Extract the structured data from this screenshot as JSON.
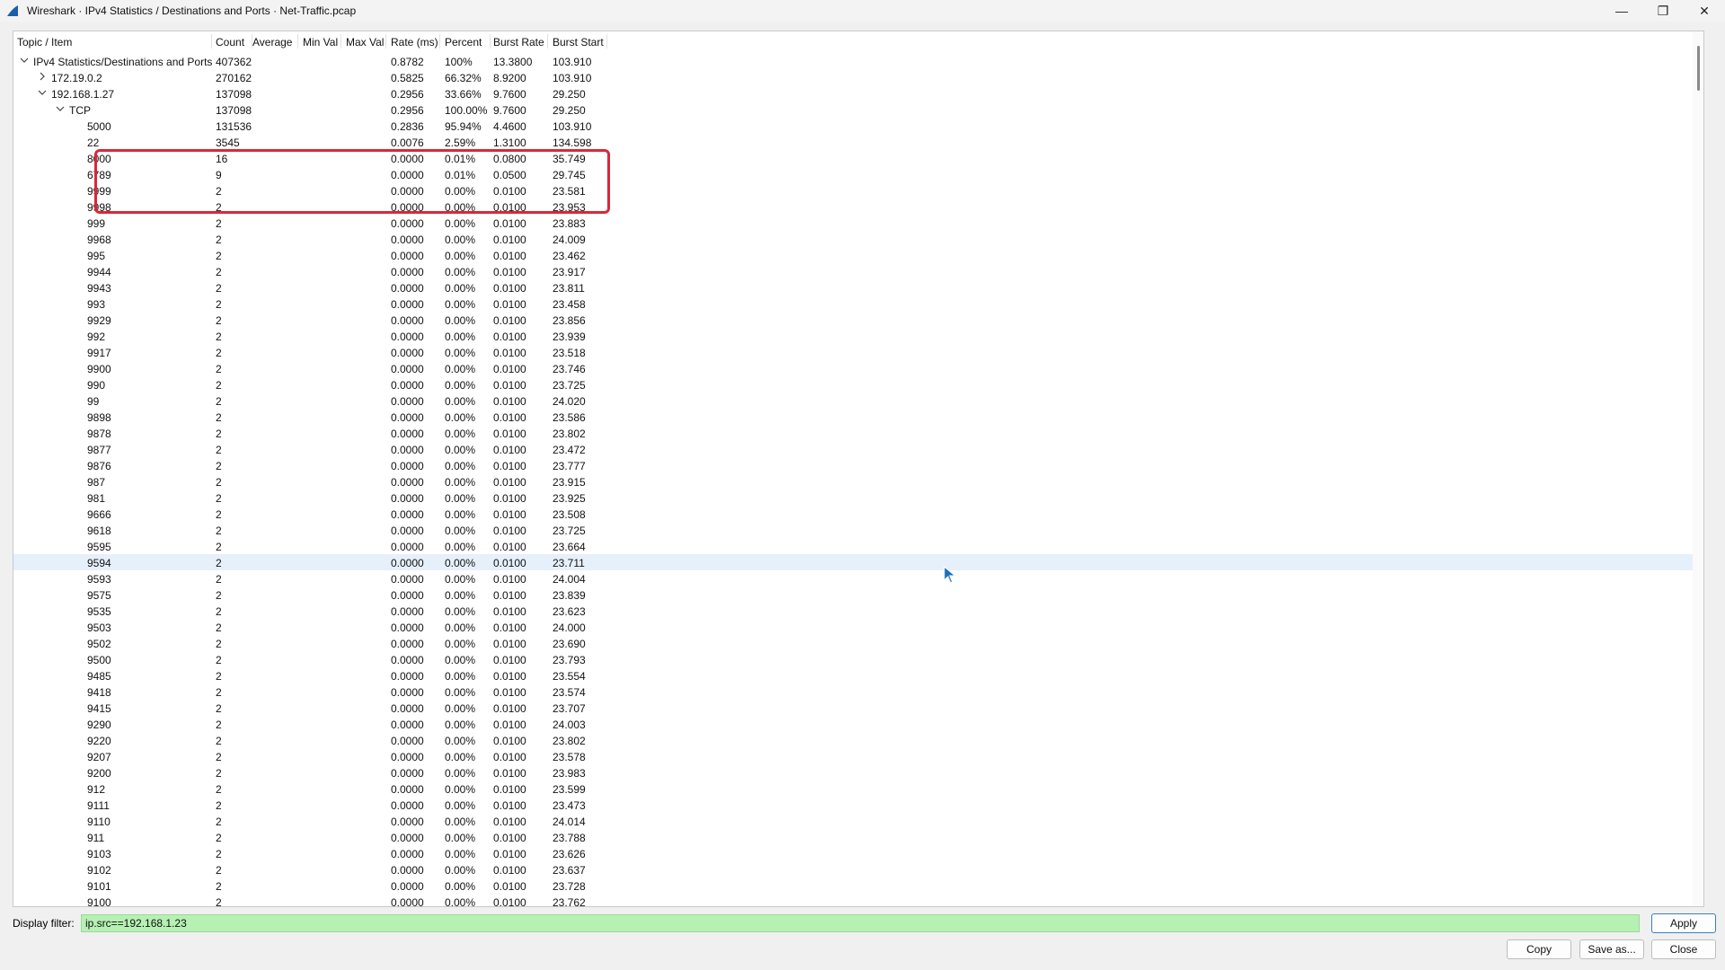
{
  "window": {
    "title": "Wireshark · IPv4 Statistics / Destinations and Ports · Net-Traffic.pcap",
    "controls": [
      "—",
      "❐",
      "✕"
    ]
  },
  "columns": [
    "Topic / Item",
    "Count",
    "Average",
    "Min Val",
    "Max Val",
    "Rate (ms)",
    "Percent",
    "Burst Rate",
    "Burst Start"
  ],
  "tree": [
    {
      "depth": 0,
      "expander": "down",
      "topic": "IPv4 Statistics/Destinations and Ports",
      "count": "407362",
      "rate": "0.8782",
      "percent": "100%",
      "burst_rate": "13.3800",
      "burst_start": "103.910"
    },
    {
      "depth": 1,
      "expander": "right",
      "topic": "172.19.0.2",
      "count": "270162",
      "rate": "0.5825",
      "percent": "66.32%",
      "burst_rate": "8.9200",
      "burst_start": "103.910"
    },
    {
      "depth": 1,
      "expander": "down",
      "topic": "192.168.1.27",
      "count": "137098",
      "rate": "0.2956",
      "percent": "33.66%",
      "burst_rate": "9.7600",
      "burst_start": "29.250"
    },
    {
      "depth": 2,
      "expander": "down",
      "topic": "TCP",
      "count": "137098",
      "rate": "0.2956",
      "percent": "100.00%",
      "burst_rate": "9.7600",
      "burst_start": "29.250"
    },
    {
      "depth": 3,
      "topic": "5000",
      "count": "131536",
      "rate": "0.2836",
      "percent": "95.94%",
      "burst_rate": "4.4600",
      "burst_start": "103.910"
    },
    {
      "depth": 3,
      "topic": "22",
      "count": "3545",
      "rate": "0.0076",
      "percent": "2.59%",
      "burst_rate": "1.3100",
      "burst_start": "134.598"
    },
    {
      "depth": 3,
      "topic": "8000",
      "count": "16",
      "rate": "0.0000",
      "percent": "0.01%",
      "burst_rate": "0.0800",
      "burst_start": "35.749"
    },
    {
      "depth": 3,
      "topic": "6789",
      "count": "9",
      "rate": "0.0000",
      "percent": "0.01%",
      "burst_rate": "0.0500",
      "burst_start": "29.745"
    },
    {
      "depth": 3,
      "topic": "9999",
      "count": "2",
      "rate": "0.0000",
      "percent": "0.00%",
      "burst_rate": "0.0100",
      "burst_start": "23.581"
    },
    {
      "depth": 3,
      "topic": "9998",
      "count": "2",
      "rate": "0.0000",
      "percent": "0.00%",
      "burst_rate": "0.0100",
      "burst_start": "23.953"
    },
    {
      "depth": 3,
      "topic": "999",
      "count": "2",
      "rate": "0.0000",
      "percent": "0.00%",
      "burst_rate": "0.0100",
      "burst_start": "23.883"
    },
    {
      "depth": 3,
      "topic": "9968",
      "count": "2",
      "rate": "0.0000",
      "percent": "0.00%",
      "burst_rate": "0.0100",
      "burst_start": "24.009"
    },
    {
      "depth": 3,
      "topic": "995",
      "count": "2",
      "rate": "0.0000",
      "percent": "0.00%",
      "burst_rate": "0.0100",
      "burst_start": "23.462"
    },
    {
      "depth": 3,
      "topic": "9944",
      "count": "2",
      "rate": "0.0000",
      "percent": "0.00%",
      "burst_rate": "0.0100",
      "burst_start": "23.917"
    },
    {
      "depth": 3,
      "topic": "9943",
      "count": "2",
      "rate": "0.0000",
      "percent": "0.00%",
      "burst_rate": "0.0100",
      "burst_start": "23.811"
    },
    {
      "depth": 3,
      "topic": "993",
      "count": "2",
      "rate": "0.0000",
      "percent": "0.00%",
      "burst_rate": "0.0100",
      "burst_start": "23.458"
    },
    {
      "depth": 3,
      "topic": "9929",
      "count": "2",
      "rate": "0.0000",
      "percent": "0.00%",
      "burst_rate": "0.0100",
      "burst_start": "23.856"
    },
    {
      "depth": 3,
      "topic": "992",
      "count": "2",
      "rate": "0.0000",
      "percent": "0.00%",
      "burst_rate": "0.0100",
      "burst_start": "23.939"
    },
    {
      "depth": 3,
      "topic": "9917",
      "count": "2",
      "rate": "0.0000",
      "percent": "0.00%",
      "burst_rate": "0.0100",
      "burst_start": "23.518"
    },
    {
      "depth": 3,
      "topic": "9900",
      "count": "2",
      "rate": "0.0000",
      "percent": "0.00%",
      "burst_rate": "0.0100",
      "burst_start": "23.746"
    },
    {
      "depth": 3,
      "topic": "990",
      "count": "2",
      "rate": "0.0000",
      "percent": "0.00%",
      "burst_rate": "0.0100",
      "burst_start": "23.725"
    },
    {
      "depth": 3,
      "topic": "99",
      "count": "2",
      "rate": "0.0000",
      "percent": "0.00%",
      "burst_rate": "0.0100",
      "burst_start": "24.020"
    },
    {
      "depth": 3,
      "topic": "9898",
      "count": "2",
      "rate": "0.0000",
      "percent": "0.00%",
      "burst_rate": "0.0100",
      "burst_start": "23.586"
    },
    {
      "depth": 3,
      "topic": "9878",
      "count": "2",
      "rate": "0.0000",
      "percent": "0.00%",
      "burst_rate": "0.0100",
      "burst_start": "23.802"
    },
    {
      "depth": 3,
      "topic": "9877",
      "count": "2",
      "rate": "0.0000",
      "percent": "0.00%",
      "burst_rate": "0.0100",
      "burst_start": "23.472"
    },
    {
      "depth": 3,
      "topic": "9876",
      "count": "2",
      "rate": "0.0000",
      "percent": "0.00%",
      "burst_rate": "0.0100",
      "burst_start": "23.777"
    },
    {
      "depth": 3,
      "topic": "987",
      "count": "2",
      "rate": "0.0000",
      "percent": "0.00%",
      "burst_rate": "0.0100",
      "burst_start": "23.915"
    },
    {
      "depth": 3,
      "topic": "981",
      "count": "2",
      "rate": "0.0000",
      "percent": "0.00%",
      "burst_rate": "0.0100",
      "burst_start": "23.925"
    },
    {
      "depth": 3,
      "topic": "9666",
      "count": "2",
      "rate": "0.0000",
      "percent": "0.00%",
      "burst_rate": "0.0100",
      "burst_start": "23.508"
    },
    {
      "depth": 3,
      "topic": "9618",
      "count": "2",
      "rate": "0.0000",
      "percent": "0.00%",
      "burst_rate": "0.0100",
      "burst_start": "23.725"
    },
    {
      "depth": 3,
      "topic": "9595",
      "count": "2",
      "rate": "0.0000",
      "percent": "0.00%",
      "burst_rate": "0.0100",
      "burst_start": "23.664"
    },
    {
      "depth": 3,
      "topic": "9594",
      "count": "2",
      "rate": "0.0000",
      "percent": "0.00%",
      "burst_rate": "0.0100",
      "burst_start": "23.711",
      "selected": true
    },
    {
      "depth": 3,
      "topic": "9593",
      "count": "2",
      "rate": "0.0000",
      "percent": "0.00%",
      "burst_rate": "0.0100",
      "burst_start": "24.004"
    },
    {
      "depth": 3,
      "topic": "9575",
      "count": "2",
      "rate": "0.0000",
      "percent": "0.00%",
      "burst_rate": "0.0100",
      "burst_start": "23.839"
    },
    {
      "depth": 3,
      "topic": "9535",
      "count": "2",
      "rate": "0.0000",
      "percent": "0.00%",
      "burst_rate": "0.0100",
      "burst_start": "23.623"
    },
    {
      "depth": 3,
      "topic": "9503",
      "count": "2",
      "rate": "0.0000",
      "percent": "0.00%",
      "burst_rate": "0.0100",
      "burst_start": "24.000"
    },
    {
      "depth": 3,
      "topic": "9502",
      "count": "2",
      "rate": "0.0000",
      "percent": "0.00%",
      "burst_rate": "0.0100",
      "burst_start": "23.690"
    },
    {
      "depth": 3,
      "topic": "9500",
      "count": "2",
      "rate": "0.0000",
      "percent": "0.00%",
      "burst_rate": "0.0100",
      "burst_start": "23.793"
    },
    {
      "depth": 3,
      "topic": "9485",
      "count": "2",
      "rate": "0.0000",
      "percent": "0.00%",
      "burst_rate": "0.0100",
      "burst_start": "23.554"
    },
    {
      "depth": 3,
      "topic": "9418",
      "count": "2",
      "rate": "0.0000",
      "percent": "0.00%",
      "burst_rate": "0.0100",
      "burst_start": "23.574"
    },
    {
      "depth": 3,
      "topic": "9415",
      "count": "2",
      "rate": "0.0000",
      "percent": "0.00%",
      "burst_rate": "0.0100",
      "burst_start": "23.707"
    },
    {
      "depth": 3,
      "topic": "9290",
      "count": "2",
      "rate": "0.0000",
      "percent": "0.00%",
      "burst_rate": "0.0100",
      "burst_start": "24.003"
    },
    {
      "depth": 3,
      "topic": "9220",
      "count": "2",
      "rate": "0.0000",
      "percent": "0.00%",
      "burst_rate": "0.0100",
      "burst_start": "23.802"
    },
    {
      "depth": 3,
      "topic": "9207",
      "count": "2",
      "rate": "0.0000",
      "percent": "0.00%",
      "burst_rate": "0.0100",
      "burst_start": "23.578"
    },
    {
      "depth": 3,
      "topic": "9200",
      "count": "2",
      "rate": "0.0000",
      "percent": "0.00%",
      "burst_rate": "0.0100",
      "burst_start": "23.983"
    },
    {
      "depth": 3,
      "topic": "912",
      "count": "2",
      "rate": "0.0000",
      "percent": "0.00%",
      "burst_rate": "0.0100",
      "burst_start": "23.599"
    },
    {
      "depth": 3,
      "topic": "9111",
      "count": "2",
      "rate": "0.0000",
      "percent": "0.00%",
      "burst_rate": "0.0100",
      "burst_start": "23.473"
    },
    {
      "depth": 3,
      "topic": "9110",
      "count": "2",
      "rate": "0.0000",
      "percent": "0.00%",
      "burst_rate": "0.0100",
      "burst_start": "24.014"
    },
    {
      "depth": 3,
      "topic": "911",
      "count": "2",
      "rate": "0.0000",
      "percent": "0.00%",
      "burst_rate": "0.0100",
      "burst_start": "23.788"
    },
    {
      "depth": 3,
      "topic": "9103",
      "count": "2",
      "rate": "0.0000",
      "percent": "0.00%",
      "burst_rate": "0.0100",
      "burst_start": "23.626"
    },
    {
      "depth": 3,
      "topic": "9102",
      "count": "2",
      "rate": "0.0000",
      "percent": "0.00%",
      "burst_rate": "0.0100",
      "burst_start": "23.637"
    },
    {
      "depth": 3,
      "topic": "9101",
      "count": "2",
      "rate": "0.0000",
      "percent": "0.00%",
      "burst_rate": "0.0100",
      "burst_start": "23.728"
    },
    {
      "depth": 3,
      "topic": "9100",
      "count": "2",
      "rate": "0.0000",
      "percent": "0.00%",
      "burst_rate": "0.0100",
      "burst_start": "23.762"
    }
  ],
  "filter": {
    "label": "Display filter:",
    "value": "ip.src==192.168.1.23"
  },
  "buttons": {
    "apply": "Apply",
    "copy": "Copy",
    "save_as": "Save as...",
    "close": "Close"
  },
  "colors": {
    "highlight": "#d9283a",
    "filter_valid": "#b6f0b3",
    "selected_row": "#e6f0fb"
  }
}
